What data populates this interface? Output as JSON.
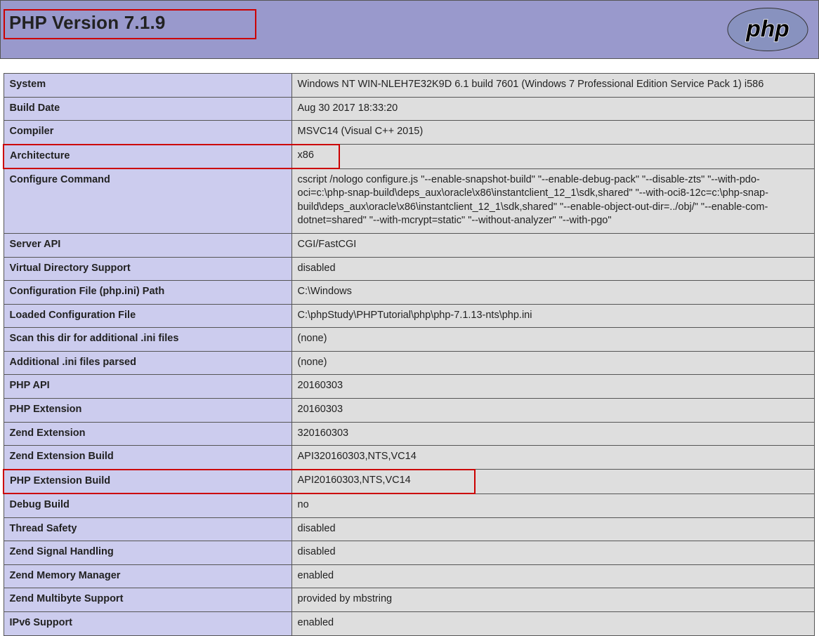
{
  "title": "PHP Version 7.1.9",
  "logo_text": "php",
  "rows": [
    {
      "key": "System",
      "val": "Windows NT WIN-NLEH7E32K9D 6.1 build 7601 (Windows 7 Professional Edition Service Pack 1) i586"
    },
    {
      "key": "Build Date",
      "val": "Aug 30 2017 18:33:20"
    },
    {
      "key": "Compiler",
      "val": "MSVC14 (Visual C++ 2015)"
    },
    {
      "key": "Architecture",
      "val": "x86",
      "highlight": "both"
    },
    {
      "key": "Configure Command",
      "val": "cscript /nologo configure.js \"--enable-snapshot-build\" \"--enable-debug-pack\" \"--disable-zts\" \"--with-pdo-oci=c:\\php-snap-build\\deps_aux\\oracle\\x86\\instantclient_12_1\\sdk,shared\" \"--with-oci8-12c=c:\\php-snap-build\\deps_aux\\oracle\\x86\\instantclient_12_1\\sdk,shared\" \"--enable-object-out-dir=../obj/\" \"--enable-com-dotnet=shared\" \"--with-mcrypt=static\" \"--without-analyzer\" \"--with-pgo\""
    },
    {
      "key": "Server API",
      "val": "CGI/FastCGI"
    },
    {
      "key": "Virtual Directory Support",
      "val": "disabled"
    },
    {
      "key": "Configuration File (php.ini) Path",
      "val": "C:\\Windows"
    },
    {
      "key": "Loaded Configuration File",
      "val": "C:\\phpStudy\\PHPTutorial\\php\\php-7.1.13-nts\\php.ini"
    },
    {
      "key": "Scan this dir for additional .ini files",
      "val": "(none)"
    },
    {
      "key": "Additional .ini files parsed",
      "val": "(none)"
    },
    {
      "key": "PHP API",
      "val": "20160303"
    },
    {
      "key": "PHP Extension",
      "val": "20160303"
    },
    {
      "key": "Zend Extension",
      "val": "320160303"
    },
    {
      "key": "Zend Extension Build",
      "val": "API320160303,NTS,VC14"
    },
    {
      "key": "PHP Extension Build",
      "val": "API20160303,NTS,VC14",
      "highlight": "wide"
    },
    {
      "key": "Debug Build",
      "val": "no"
    },
    {
      "key": "Thread Safety",
      "val": "disabled"
    },
    {
      "key": "Zend Signal Handling",
      "val": "disabled"
    },
    {
      "key": "Zend Memory Manager",
      "val": "enabled"
    },
    {
      "key": "Zend Multibyte Support",
      "val": "provided by mbstring"
    },
    {
      "key": "IPv6 Support",
      "val": "enabled"
    }
  ]
}
